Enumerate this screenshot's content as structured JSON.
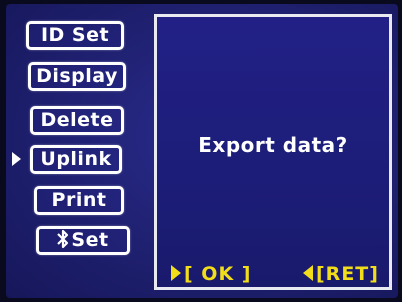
{
  "menu": {
    "items": [
      {
        "label": "ID Set"
      },
      {
        "label": "Display"
      },
      {
        "label": "Delete"
      },
      {
        "label": "Uplink",
        "selected": true
      },
      {
        "label": "Print"
      },
      {
        "label": "Set",
        "icon": "bluetooth-icon"
      }
    ]
  },
  "dialog": {
    "message": "Export data?",
    "ok_label": "[ OK ]",
    "ret_label": "[RET]"
  },
  "colors": {
    "background": "#1f2070",
    "softkey": "#f2dd1a",
    "text": "#ffffff"
  }
}
